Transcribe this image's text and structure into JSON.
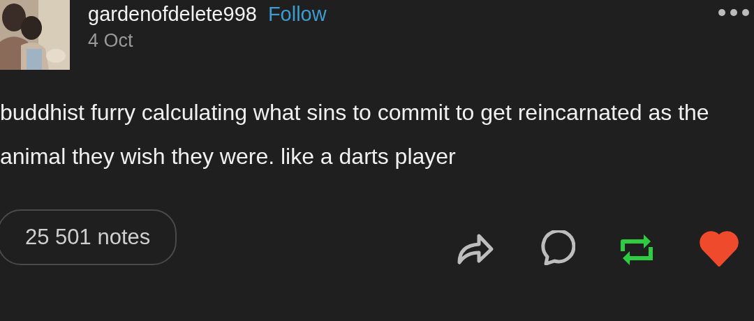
{
  "post": {
    "author": "gardenofdelete998",
    "follow": "Follow",
    "date": "4 Oct",
    "text": "buddhist furry calculating what sins to commit to get reincarnated as the animal they wish they were. like a darts player",
    "notes": "25 501 notes",
    "reblogged": true,
    "liked": true
  }
}
